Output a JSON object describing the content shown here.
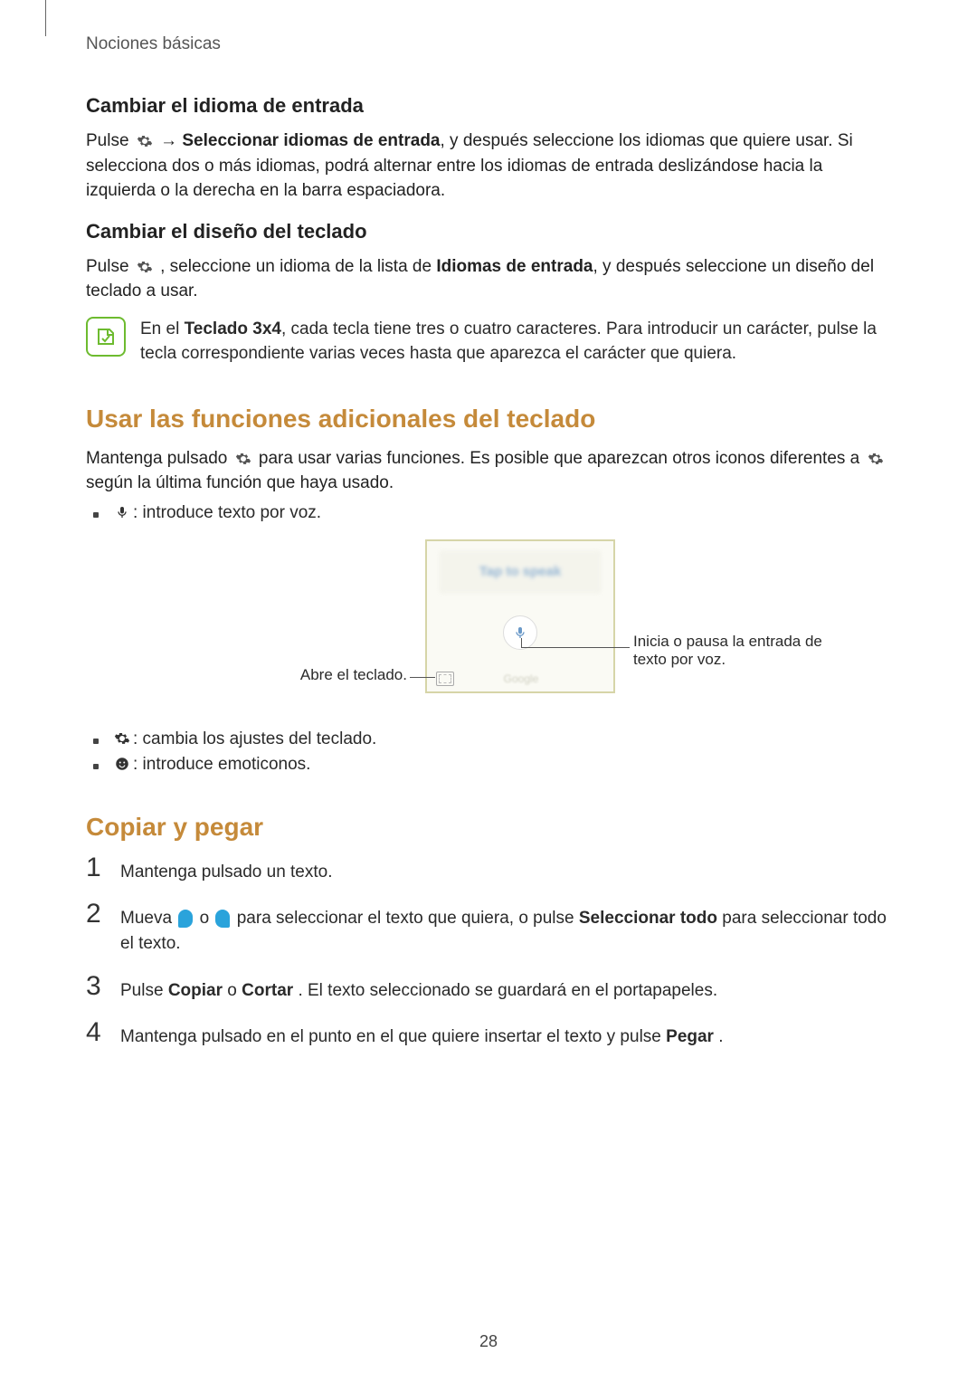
{
  "breadcrumb": "Nociones básicas",
  "s1": {
    "title": "Cambiar el idioma de entrada",
    "p1a": "Pulse ",
    "p1b": " → ",
    "p1c": "Seleccionar idiomas de entrada",
    "p1d": ", y después seleccione los idiomas que quiere usar. Si selecciona dos o más idiomas, podrá alternar entre los idiomas de entrada deslizándose hacia la izquierda o la derecha en la barra espaciadora."
  },
  "s2": {
    "title": "Cambiar el diseño del teclado",
    "p1a": "Pulse ",
    "p1b": ", seleccione un idioma de la lista de ",
    "p1c": "Idiomas de entrada",
    "p1d": ", y después seleccione un diseño del teclado a usar.",
    "note_a": "En el ",
    "note_b": "Teclado 3x4",
    "note_c": ", cada tecla tiene tres o cuatro caracteres. Para introducir un carácter, pulse la tecla correspondiente varias veces hasta que aparezca el carácter que quiera."
  },
  "s3": {
    "title": "Usar las funciones adicionales del teclado",
    "p1a": "Mantenga pulsado ",
    "p1b": " para usar varias funciones. Es posible que aparezcan otros iconos diferentes a ",
    "p1c": " según la última función que haya usado.",
    "b1": " : introduce texto por voz.",
    "b2": " : cambia los ajustes del teclado.",
    "b3": " : introduce emoticonos.",
    "diagram": {
      "tap": "Tap to speak",
      "google": "Google",
      "left": "Abre el teclado.",
      "right": "Inicia o pausa la entrada de texto por voz."
    }
  },
  "s4": {
    "title": "Copiar y pegar",
    "steps": {
      "n1": "1",
      "t1": "Mantenga pulsado un texto.",
      "n2": "2",
      "t2a": "Mueva ",
      "t2b": " o ",
      "t2c": " para seleccionar el texto que quiera, o pulse ",
      "t2d": "Seleccionar todo",
      "t2e": " para seleccionar todo el texto.",
      "n3": "3",
      "t3a": "Pulse ",
      "t3b": "Copiar",
      "t3c": " o ",
      "t3d": "Cortar",
      "t3e": ". El texto seleccionado se guardará en el portapapeles.",
      "n4": "4",
      "t4a": "Mantenga pulsado en el punto en el que quiere insertar el texto y pulse ",
      "t4b": "Pegar",
      "t4c": "."
    }
  },
  "page_number": "28"
}
